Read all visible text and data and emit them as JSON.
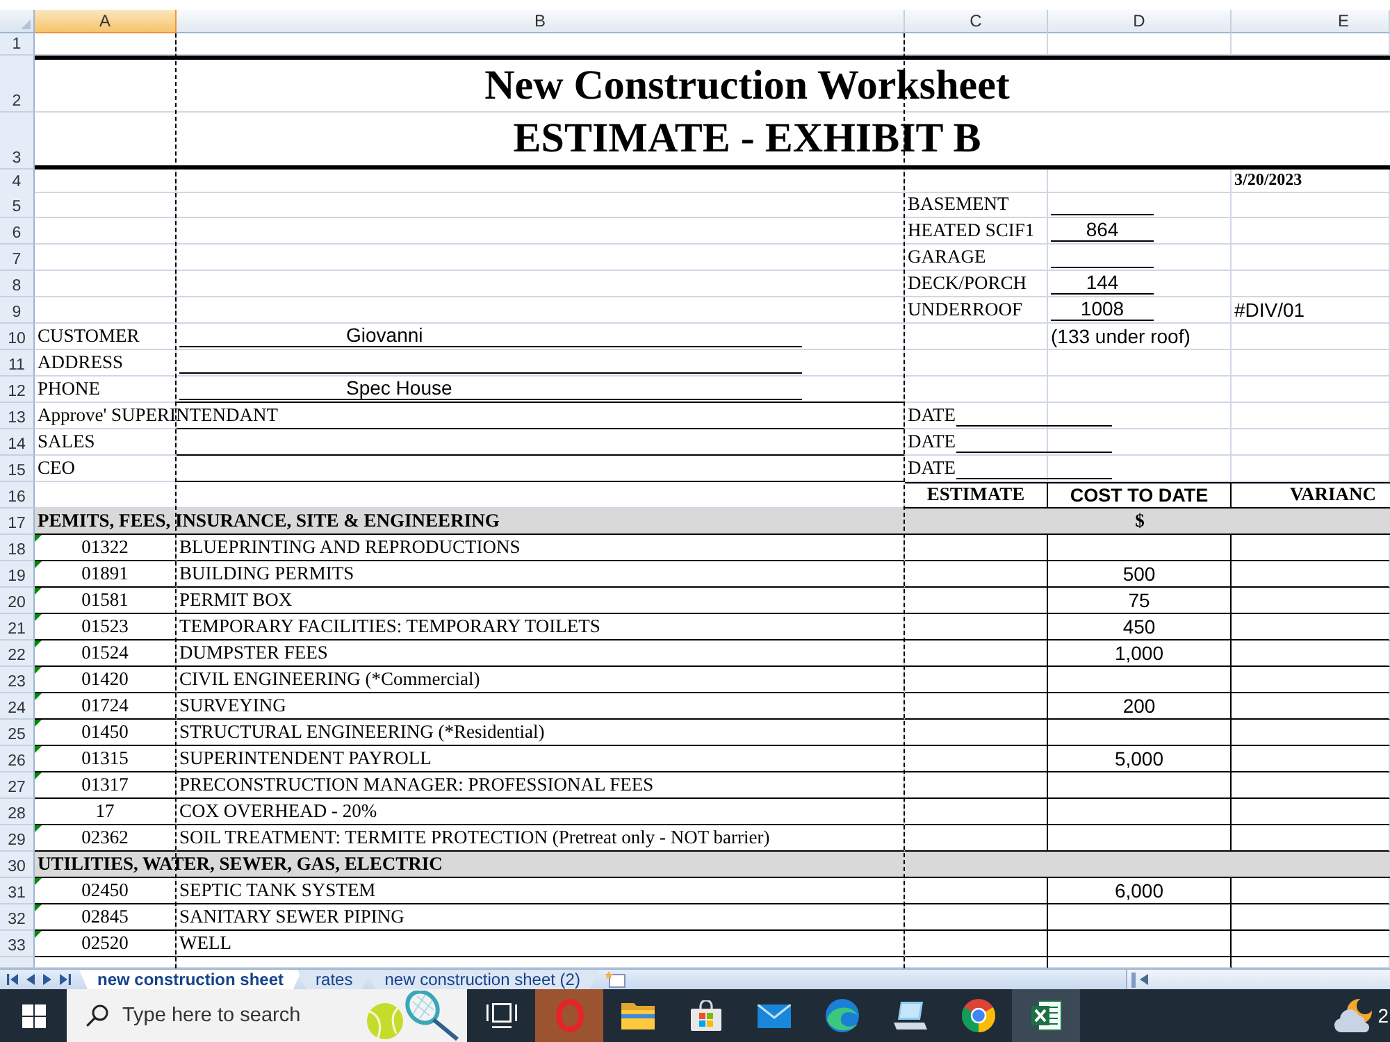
{
  "sheet": {
    "columns": [
      {
        "label": "A",
        "selected": true
      },
      {
        "label": "B",
        "selected": false
      },
      {
        "label": "C",
        "selected": false
      },
      {
        "label": "D",
        "selected": false
      },
      {
        "label": "E",
        "selected": false
      }
    ],
    "rows": [
      {
        "number": "1",
        "kind": "blank"
      },
      {
        "number": "2",
        "kind": "title",
        "text": "New Construction Worksheet"
      },
      {
        "number": "3",
        "kind": "title",
        "text": "ESTIMATE - EXHIBIT B"
      },
      {
        "number": "4",
        "kind": "date",
        "text": "3/20/2023"
      },
      {
        "number": "5",
        "kind": "area",
        "label": "BASEMENT"
      },
      {
        "number": "6",
        "kind": "area",
        "label": "HEATED SCIF1",
        "value": "864"
      },
      {
        "number": "7",
        "kind": "area",
        "label": "GARAGE"
      },
      {
        "number": "8",
        "kind": "area",
        "label": "DECK/PORCH",
        "value": "144"
      },
      {
        "number": "9",
        "kind": "area",
        "label": "UNDERROOF",
        "value": "1008",
        "note": "#DIV/01"
      },
      {
        "number": "10",
        "kind": "info",
        "label": "CUSTOMER",
        "value": "Giovanni",
        "note": "(133 under roof)"
      },
      {
        "number": "11",
        "kind": "info",
        "label": "ADDRESS"
      },
      {
        "number": "12",
        "kind": "info",
        "label": "PHONE",
        "value": "Spec House"
      },
      {
        "number": "13",
        "kind": "approval",
        "label": "Approve' SUPERINTENDANT",
        "date_label": "DATE"
      },
      {
        "number": "14",
        "kind": "approval",
        "label": "SALES",
        "date_label": "DATE"
      },
      {
        "number": "15",
        "kind": "approval",
        "label": "CEO",
        "date_label": "DATE"
      },
      {
        "number": "16",
        "kind": "header",
        "cells": [
          "ESTIMATE",
          "COST TO DATE",
          "VARIANC"
        ]
      },
      {
        "number": "17",
        "kind": "section",
        "text": "PEMITS, FEES, INSURANCE, SITE & ENGINEERING",
        "unit": "$"
      },
      {
        "number": "18",
        "kind": "item",
        "code": "01322",
        "description": "BLUEPRINTING AND REPRODUCTIONS",
        "flagged": true
      },
      {
        "number": "19",
        "kind": "item",
        "code": "01891",
        "description": "BUILDING PERMITS",
        "cost": "500",
        "flagged": true
      },
      {
        "number": "20",
        "kind": "item",
        "code": "01581",
        "description": "PERMIT BOX",
        "cost": "75",
        "flagged": true
      },
      {
        "number": "21",
        "kind": "item",
        "code": "01523",
        "description": "TEMPORARY FACILITIES: TEMPORARY TOILETS",
        "cost": "450",
        "flagged": true
      },
      {
        "number": "22",
        "kind": "item",
        "code": "01524",
        "description": "DUMPSTER FEES",
        "cost": "1,000",
        "flagged": true
      },
      {
        "number": "23",
        "kind": "item",
        "code": "01420",
        "description": "CIVIL ENGINEERING (*Commercial)",
        "flagged": true
      },
      {
        "number": "24",
        "kind": "item",
        "code": "01724",
        "description": "SURVEYING",
        "cost": "200",
        "flagged": true
      },
      {
        "number": "25",
        "kind": "item",
        "code": "01450",
        "description": "STRUCTURAL ENGINEERING (*Residential)",
        "flagged": true
      },
      {
        "number": "26",
        "kind": "item",
        "code": "01315",
        "description": "SUPERINTENDENT PAYROLL",
        "cost": "5,000",
        "flagged": true
      },
      {
        "number": "27",
        "kind": "item",
        "code": "01317",
        "description": "PRECONSTRUCTION MANAGER: PROFESSIONAL FEES",
        "flagged": true
      },
      {
        "number": "28",
        "kind": "item",
        "code": "17",
        "description": "COX OVERHEAD - 20%",
        "flagged": false
      },
      {
        "number": "29",
        "kind": "item",
        "code": "02362",
        "description": "SOIL TREATMENT: TERMITE PROTECTION (Pretreat only - NOT barrier)",
        "flagged": true
      },
      {
        "number": "30",
        "kind": "section",
        "text": "UTILITIES, WATER, SEWER, GAS, ELECTRIC"
      },
      {
        "number": "31",
        "kind": "item",
        "code": "02450",
        "description": "SEPTIC TANK SYSTEM",
        "cost": "6,000",
        "flagged": true
      },
      {
        "number": "32",
        "kind": "item",
        "code": "02845",
        "description": "SANITARY SEWER PIPING",
        "flagged": true
      },
      {
        "number": "33",
        "kind": "item",
        "code": "02520",
        "description": "WELL",
        "flagged": true
      }
    ]
  },
  "sheet_tabs": [
    {
      "label": "new construction sheet",
      "selected": true
    },
    {
      "label": "rates",
      "selected": false
    },
    {
      "label": "new construction sheet (2)",
      "selected": false
    }
  ],
  "taskbar": {
    "search": {
      "placeholder": "Type here to search"
    },
    "apps": [
      {
        "kind": "task-view",
        "selected": false,
        "flashing": false
      },
      {
        "kind": "ring",
        "selected": false,
        "flashing": true
      },
      {
        "kind": "folder",
        "selected": false,
        "flashing": false
      },
      {
        "kind": "bag",
        "selected": false,
        "flashing": false
      },
      {
        "kind": "mail",
        "selected": false,
        "flashing": false
      },
      {
        "kind": "swirl",
        "selected": false,
        "flashing": false
      },
      {
        "kind": "computer",
        "selected": false,
        "flashing": false
      },
      {
        "kind": "segmented-circle",
        "selected": false,
        "flashing": false
      },
      {
        "kind": "sheet",
        "selected": true,
        "flashing": false
      }
    ],
    "tray_text": "2"
  }
}
